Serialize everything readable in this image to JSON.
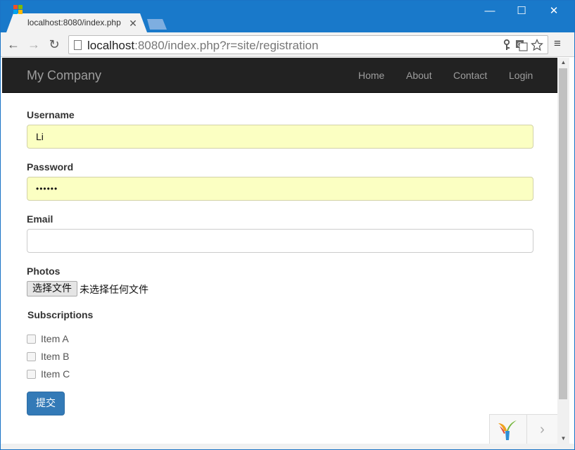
{
  "browser": {
    "tab_title": "localhost:8080/index.php",
    "tab_close": "✕",
    "window_controls": {
      "minimize": "—",
      "maximize": "☐",
      "close": "✕"
    },
    "nav": {
      "back": "←",
      "forward": "→",
      "reload": "↻"
    },
    "url_host": "localhost",
    "url_rest": ":8080/index.php?r=site/registration",
    "omnibox_icons": [
      "key-icon",
      "translate-icon",
      "star-icon"
    ],
    "menu": "≡"
  },
  "navbar": {
    "brand": "My Company",
    "items": [
      "Home",
      "About",
      "Contact",
      "Login"
    ]
  },
  "form": {
    "username_label": "Username",
    "username_value": "Li",
    "password_label": "Password",
    "password_value": "••••••",
    "email_label": "Email",
    "email_value": "",
    "photos_label": "Photos",
    "file_button": "选择文件",
    "file_status": "未选择任何文件",
    "subscriptions_label": "Subscriptions",
    "subscriptions": [
      "Item A",
      "Item B",
      "Item C"
    ],
    "submit": "提交"
  },
  "debug_toolbar": {
    "arrow": "›"
  },
  "colors": {
    "titlebar": "#1979ca",
    "navbar": "#222222",
    "autofill": "#fbffc2",
    "primary_button": "#337ab7"
  }
}
